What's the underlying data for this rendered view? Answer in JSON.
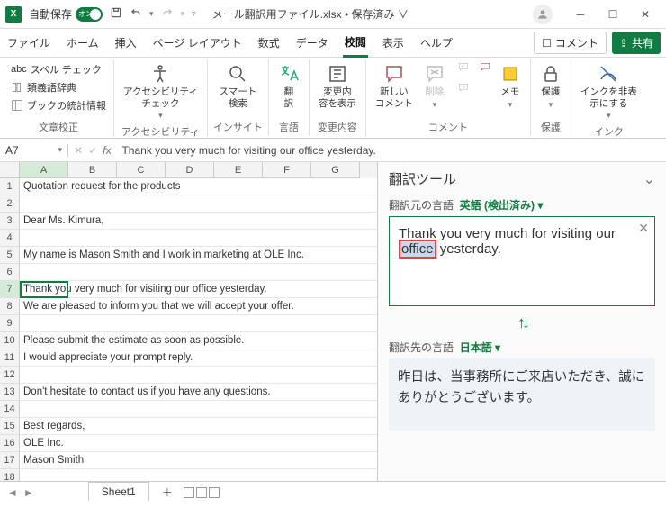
{
  "titlebar": {
    "autosave_label": "自動保存",
    "autosave_on": "オン",
    "document": "メール翻訳用ファイル.xlsx • 保存済み ∨"
  },
  "tabs": {
    "file": "ファイル",
    "home": "ホーム",
    "insert": "挿入",
    "pagelayout": "ページ レイアウト",
    "formulas": "数式",
    "data": "データ",
    "review": "校閲",
    "view": "表示",
    "help": "ヘルプ",
    "comments": "コメント",
    "share": "共有"
  },
  "ribbon": {
    "proofing": {
      "spell": "スペル チェック",
      "thesaurus": "類義語辞典",
      "stats": "ブックの統計情報",
      "group": "文章校正"
    },
    "accessibility": {
      "btn": "アクセシビリティ\nチェック",
      "group": "アクセシビリティ"
    },
    "insights": {
      "btn": "スマート\n検索",
      "group": "インサイト"
    },
    "language": {
      "btn": "翻\n訳",
      "group": "言語"
    },
    "changes": {
      "btn": "変更内\n容を表示",
      "group": "変更内容"
    },
    "comments_grp": {
      "new": "新しい\nコメント",
      "delete": "削除",
      "notes": "メモ",
      "group": "コメント"
    },
    "protect": {
      "btn": "保護",
      "group": "保護"
    },
    "ink": {
      "btn": "インクを非表\n示にする",
      "group": "インク"
    }
  },
  "namebox": "A7",
  "formula_bar": "Thank you very much for visiting our office yesterday.",
  "columns": [
    "A",
    "B",
    "C",
    "D",
    "E",
    "F",
    "G"
  ],
  "rows": [
    {
      "n": 1,
      "text": "Quotation request for the products"
    },
    {
      "n": 2,
      "text": ""
    },
    {
      "n": 3,
      "text": "Dear Ms. Kimura,"
    },
    {
      "n": 4,
      "text": ""
    },
    {
      "n": 5,
      "text": "My name is Mason Smith and I work in marketing at OLE Inc."
    },
    {
      "n": 6,
      "text": ""
    },
    {
      "n": 7,
      "text": "Thank you very much for visiting our office yesterday."
    },
    {
      "n": 8,
      "text": "We are pleased to inform you that we will accept your offer."
    },
    {
      "n": 9,
      "text": ""
    },
    {
      "n": 10,
      "text": "Please submit the estimate as soon as possible."
    },
    {
      "n": 11,
      "text": "I would appreciate your prompt reply."
    },
    {
      "n": 12,
      "text": ""
    },
    {
      "n": 13,
      "text": "Don't hesitate to contact us if you have any questions."
    },
    {
      "n": 14,
      "text": ""
    },
    {
      "n": 15,
      "text": "Best regards,"
    },
    {
      "n": 16,
      "text": "OLE Inc."
    },
    {
      "n": 17,
      "text": "Mason Smith"
    },
    {
      "n": 18,
      "text": ""
    }
  ],
  "sheet_tab": "Sheet1",
  "translator": {
    "title": "翻訳ツール",
    "from_label": "翻訳元の言語",
    "from_lang": "英語 (検出済み)",
    "source_before": "Thank you very much for visiting our ",
    "source_highlight": "office",
    "source_after": " yesterday.",
    "to_label": "翻訳先の言語",
    "to_lang": "日本語",
    "target": "昨日は、当事務所にご来店いただき、誠にありがとうございます。"
  }
}
